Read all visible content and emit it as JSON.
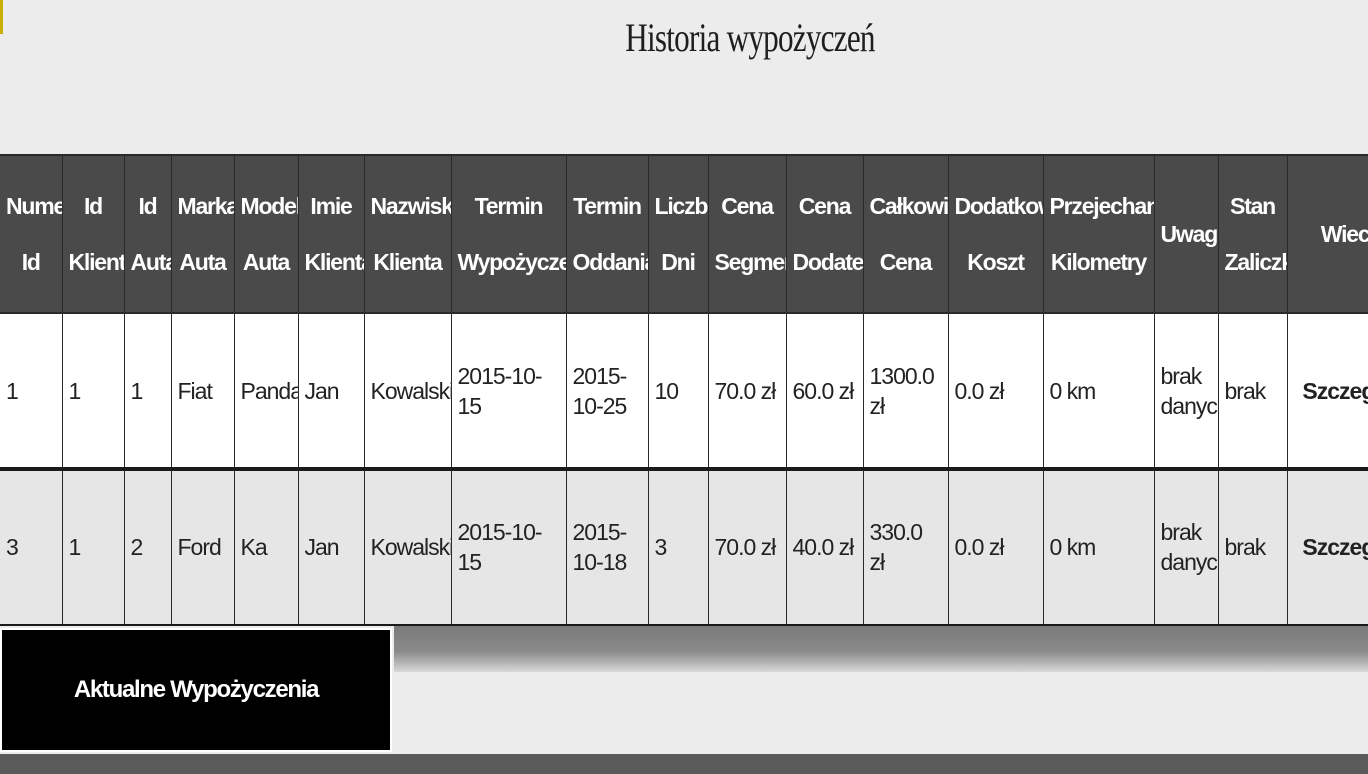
{
  "page": {
    "title": "Historia wypożyczeń"
  },
  "table": {
    "headers": [
      [
        "Numer",
        "Id"
      ],
      [
        "Id",
        "Klienta"
      ],
      [
        "Id",
        "Auta"
      ],
      [
        "Marka",
        "Auta"
      ],
      [
        "Model",
        "Auta"
      ],
      [
        "Imie",
        "Klienta"
      ],
      [
        "Nazwisko",
        "Klienta"
      ],
      [
        "Termin",
        "Wypożyczenia"
      ],
      [
        "Termin",
        "Oddania"
      ],
      [
        "Liczba",
        "Dni"
      ],
      [
        "Cena",
        "Segment"
      ],
      [
        "Cena",
        "Dodatek"
      ],
      [
        "Całkowita",
        "Cena"
      ],
      [
        "Dodatkowy",
        "Koszt"
      ],
      [
        "Przejechane",
        "Kilometry"
      ],
      [
        "Uwagi",
        ""
      ],
      [
        "Stan",
        "Zaliczki"
      ],
      [
        "Wiecej",
        ""
      ]
    ],
    "rows": [
      {
        "cells": [
          "1",
          "1",
          "1",
          "Fiat",
          "Panda",
          "Jan",
          "Kowalski",
          "2015-10-15",
          "2015-10-25",
          "10",
          "70.0 zł",
          "60.0 zł",
          "1300.0 zł",
          "0.0 zł",
          "0 km",
          "brak danych",
          "brak"
        ],
        "more_label": "Szczegóły"
      },
      {
        "cells": [
          "3",
          "1",
          "2",
          "Ford",
          "Ka",
          "Jan",
          "Kowalski",
          "2015-10-15",
          "2015-10-18",
          "3",
          "70.0 zł",
          "40.0 zł",
          "330.0 zł",
          "0.0 zł",
          "0 km",
          "brak danych",
          "brak"
        ],
        "more_label": "Szczegóły"
      }
    ]
  },
  "actions": {
    "current_rentals_label": "Aktualne Wypożyczenia"
  },
  "colors": {
    "header_bg": "#4a4a4a",
    "row_alt_bg": "#e6e6e6",
    "button_bg": "#000000"
  }
}
